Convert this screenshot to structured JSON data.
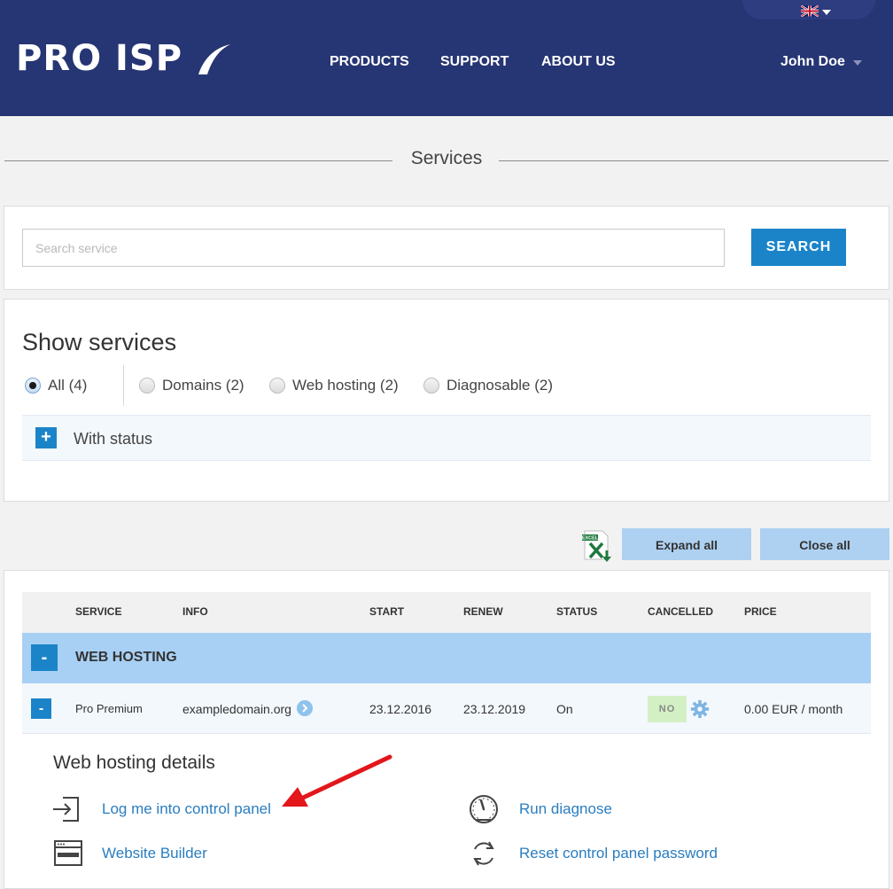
{
  "header": {
    "logo": "PRO ISP",
    "language_flag": "uk-flag-icon",
    "nav": [
      "PRODUCTS",
      "SUPPORT",
      "ABOUT US"
    ],
    "user_name": "John Doe"
  },
  "page": {
    "title": "Services"
  },
  "search": {
    "placeholder": "Search service",
    "value": "",
    "button": "SEARCH"
  },
  "filters": {
    "title": "Show services",
    "options": [
      {
        "label": "All (4)",
        "checked": true
      },
      {
        "label": "Domains (2)",
        "checked": false
      },
      {
        "label": "Web hosting (2)",
        "checked": false
      },
      {
        "label": "Diagnosable (2)",
        "checked": false
      }
    ],
    "status_toggle": "+",
    "status_label": "With status"
  },
  "toolbar": {
    "export_icon": "excel-export-icon",
    "expand_all": "Expand all",
    "close_all": "Close all"
  },
  "table": {
    "columns": [
      "SERVICE",
      "INFO",
      "START",
      "RENEW",
      "STATUS",
      "CANCELLED",
      "PRICE"
    ],
    "group": {
      "toggle": "-",
      "label": "WEB HOSTING"
    },
    "rows": [
      {
        "toggle": "-",
        "service": "Pro Premium",
        "info": "exampledomain.org",
        "start": "23.12.2016",
        "renew": "23.12.2019",
        "status": "On",
        "cancelled": "NO",
        "price": "0.00 EUR / month"
      }
    ]
  },
  "details": {
    "title": "Web hosting details",
    "links": {
      "login": "Log me into control panel",
      "diagnose": "Run diagnose",
      "builder": "Website Builder",
      "reset": "Reset control panel password"
    }
  },
  "colors": {
    "header_bg": "#263573",
    "accent": "#1b84c9",
    "group_row": "#a8d0f4",
    "link": "#2a7dc0",
    "annotation_arrow": "#e3161b"
  }
}
